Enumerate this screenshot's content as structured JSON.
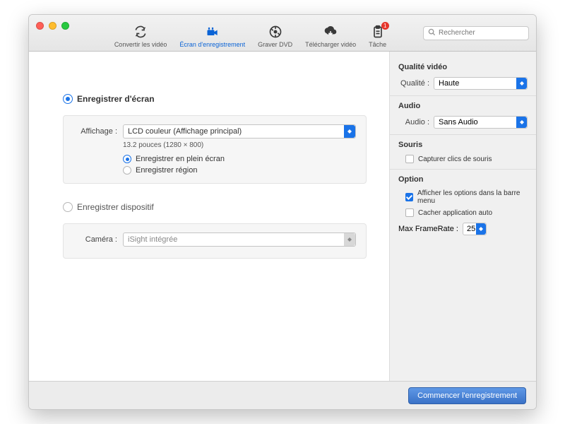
{
  "toolbar": {
    "items": [
      {
        "label": "Convertir les vidéo"
      },
      {
        "label": "Écran d'enregistrement"
      },
      {
        "label": "Graver DVD"
      },
      {
        "label": "Télécharger vidéo"
      },
      {
        "label": "Tâche",
        "badge": "1"
      }
    ],
    "search_placeholder": "Rechercher"
  },
  "main": {
    "record_screen_label": "Enregistrer d'écran",
    "display_label": "Affichage :",
    "display_value": "LCD couleur (Affichage principal)",
    "display_sub": "13.2 pouces (1280 × 800)",
    "fullscreen_label": "Enregistrer en plein écran",
    "region_label": "Enregistrer région",
    "record_device_label": "Enregistrer dispositif",
    "camera_label": "Caméra :",
    "camera_value": "iSight intégrée"
  },
  "side": {
    "quality_section": "Qualité vidéo",
    "quality_label": "Qualité :",
    "quality_value": "Haute",
    "audio_section": "Audio",
    "audio_label": "Audio :",
    "audio_value": "Sans Audio",
    "mouse_section": "Souris",
    "capture_clicks_label": "Capturer clics de souris",
    "option_section": "Option",
    "show_menu_label": "Afficher les options dans la barre menu",
    "hide_app_label": "Cacher application auto",
    "max_framerate_label": "Max FrameRate :",
    "max_framerate_value": "25"
  },
  "footer": {
    "start_label": "Commencer l'enregistrement"
  }
}
